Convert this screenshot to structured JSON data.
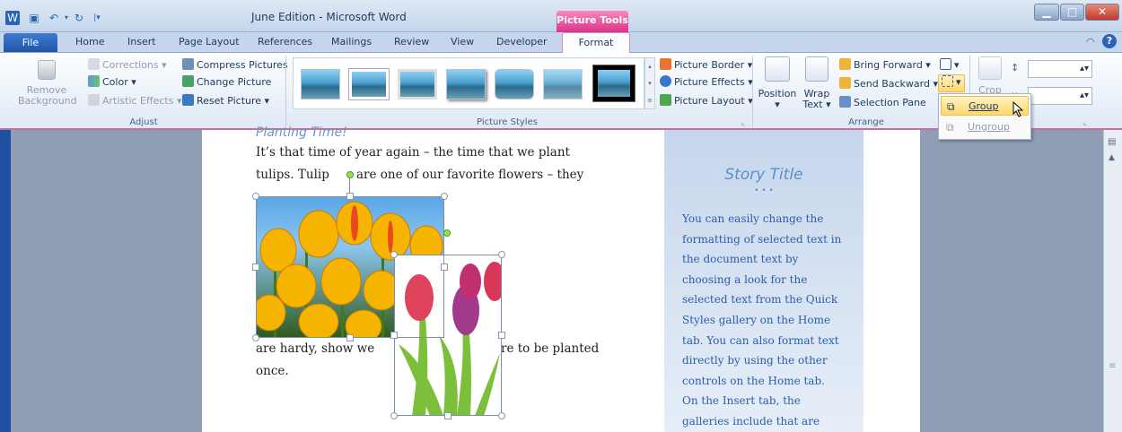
{
  "window": {
    "title": "June Edition - Microsoft Word",
    "context_tab": "Picture Tools"
  },
  "tabs": [
    "File",
    "Home",
    "Insert",
    "Page Layout",
    "References",
    "Mailings",
    "Review",
    "View",
    "Developer",
    "Format"
  ],
  "adjust": {
    "remove_background": "Remove Background",
    "corrections": "Corrections",
    "color": "Color",
    "artistic_effects": "Artistic Effects",
    "compress": "Compress Pictures",
    "change": "Change Picture",
    "reset": "Reset Picture",
    "label": "Adjust"
  },
  "styles": {
    "picture_border": "Picture Border",
    "picture_effects": "Picture Effects",
    "picture_layout": "Picture Layout",
    "label": "Picture Styles"
  },
  "arrange": {
    "position": "Position",
    "wrap_text": "Wrap Text",
    "bring_forward": "Bring Forward",
    "send_backward": "Send Backward",
    "selection_pane": "Selection Pane",
    "label": "Arrange"
  },
  "size": {
    "crop": "Crop"
  },
  "group_menu": {
    "group": "Group",
    "ungroup": "Ungroup"
  },
  "document": {
    "heading": "Planting Time!",
    "line1": "It’s that time of year again – the time that we plant",
    "line2a": "tulips. Tulip",
    "line2b": "are one of our favorite flowers – they",
    "line3a": "are hardy, show we",
    "line3b": "re to be planted",
    "line4": "once."
  },
  "sidebar": {
    "title": "Story Title",
    "dots": "• • •",
    "lines": [
      "You can easily change the",
      "formatting of selected text in",
      "the document text by",
      "choosing a look for the",
      "selected text from the Quick",
      "Styles gallery on the Home",
      "tab. You can also format text",
      "directly by using the other",
      "controls on the Home tab.",
      "On the Insert tab, the",
      "galleries include that are"
    ]
  },
  "colors": {
    "accent_pink": "#d9348a",
    "ribbon_blue": "#c5d6ec",
    "file_blue": "#2a63b8"
  }
}
